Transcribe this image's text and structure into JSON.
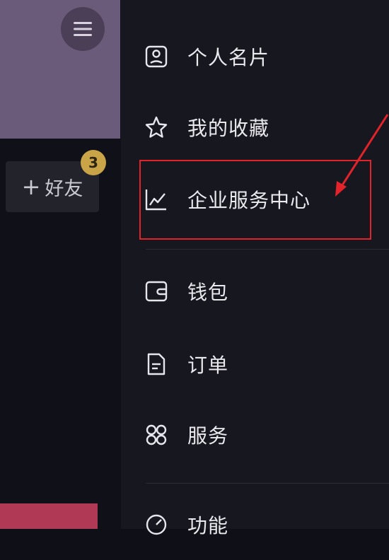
{
  "left": {
    "add_friend_label": "好友",
    "add_friend_badge": "3"
  },
  "menu": {
    "items": [
      {
        "label": "个人名片",
        "icon": "id-card-icon"
      },
      {
        "label": "我的收藏",
        "icon": "star-icon"
      },
      {
        "label": "企业服务中心",
        "icon": "chart-line-icon"
      },
      {
        "label": "钱包",
        "icon": "wallet-icon"
      },
      {
        "label": "订单",
        "icon": "document-icon"
      },
      {
        "label": "服务",
        "icon": "grid-icon"
      },
      {
        "label": "功能",
        "icon": "gauge-icon"
      }
    ]
  },
  "colors": {
    "highlight": "#e2232a",
    "badge": "#c9a548",
    "drawer_bg": "#16171f"
  }
}
